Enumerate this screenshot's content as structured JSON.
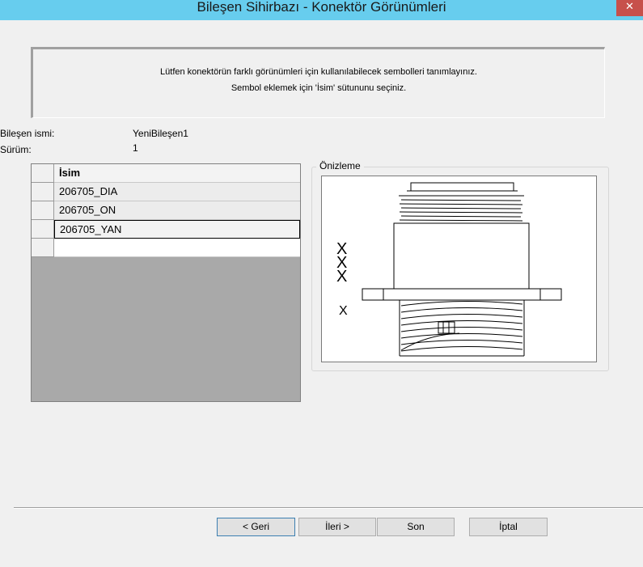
{
  "window": {
    "title": "Bileşen Sihirbazı - Konektör Görünümleri",
    "close_label": "✕"
  },
  "instructions": {
    "line1": "Lütfen konektörün farklı görünümleri için kullanılabilecek sembolleri tanımlayınız.",
    "line2": "Sembol eklemek için 'İsim' sütununu seçiniz."
  },
  "component": {
    "name_label": "Bileşen ismi:",
    "name_value": "YeniBileşen1",
    "version_label": "Sürüm:",
    "version_value": "1"
  },
  "grid": {
    "header": "İsim",
    "rows": [
      "206705_DIA",
      "206705_ON",
      "206705_YAN"
    ],
    "new_row_value": ""
  },
  "preview": {
    "label": "Önizleme",
    "markers": [
      "X",
      "X",
      "X",
      "X"
    ]
  },
  "buttons": {
    "back": "< Geri",
    "next": "İleri >",
    "finish": "Son",
    "cancel": "İptal"
  }
}
